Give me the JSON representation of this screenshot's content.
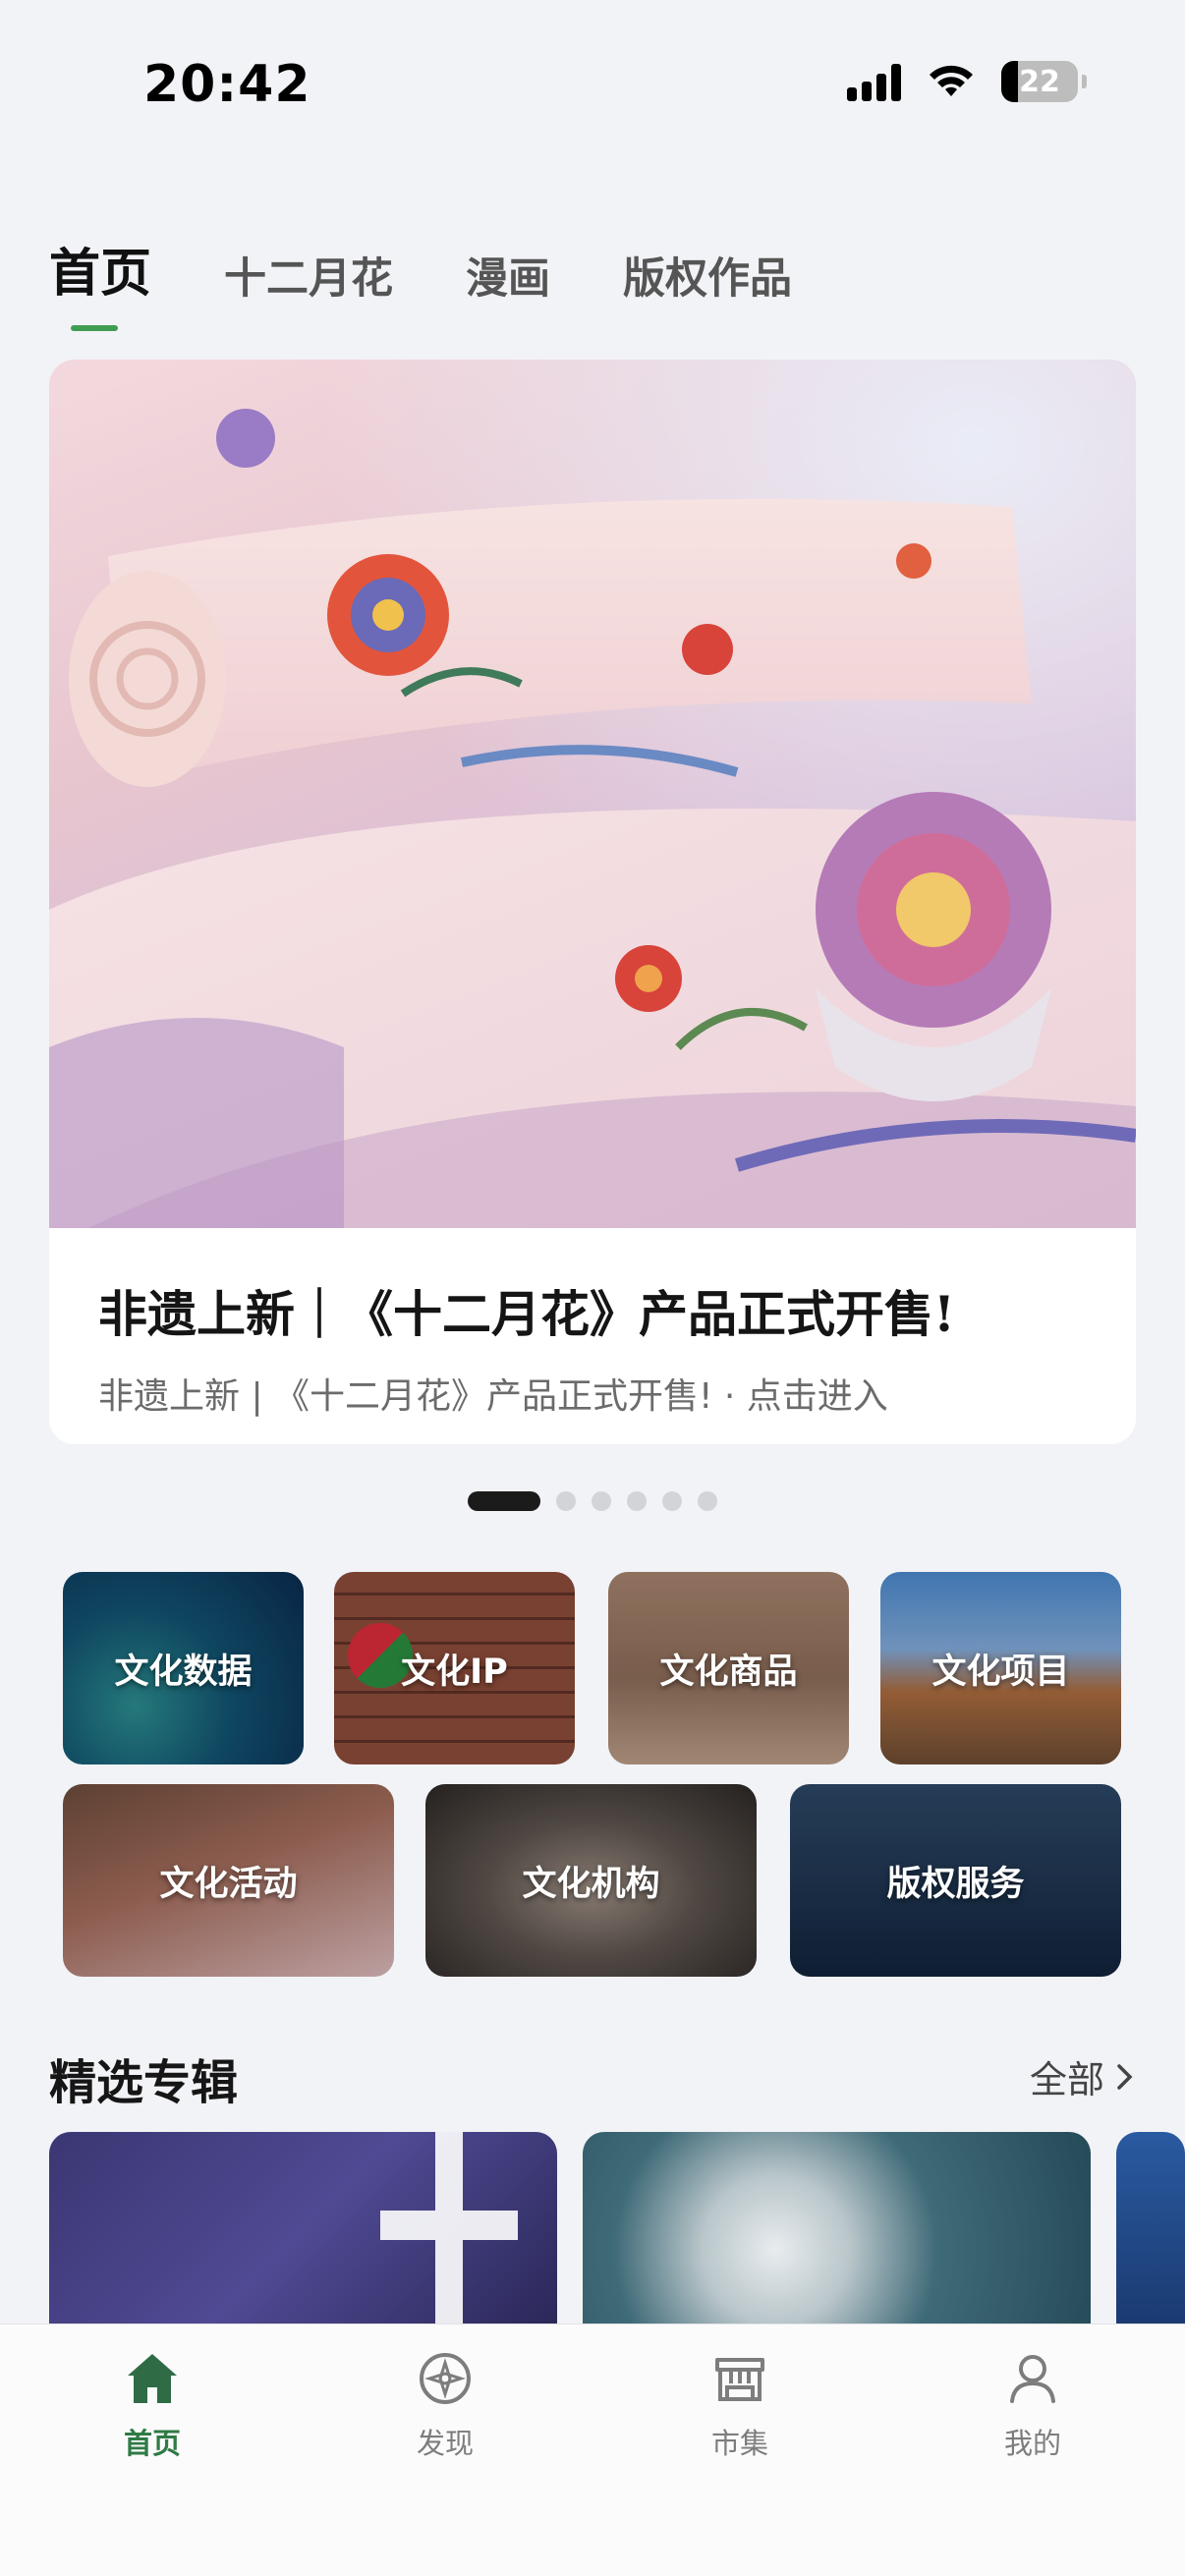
{
  "status_bar": {
    "time": "20:42",
    "battery": "22"
  },
  "top_tabs": [
    {
      "label": "首页",
      "active": true
    },
    {
      "label": "十二月花",
      "active": false
    },
    {
      "label": "漫画",
      "active": false
    },
    {
      "label": "版权作品",
      "active": false
    }
  ],
  "banner": {
    "title": "非遗上新｜《十二月花》产品正式开售!",
    "subtitle": "非遗上新 | 《十二月花》产品正式开售!  · 点击进入",
    "dot_count": 6,
    "active_dot": 0
  },
  "categories": [
    {
      "label": "文化数据"
    },
    {
      "label": "文化IP"
    },
    {
      "label": "文化商品"
    },
    {
      "label": "文化项目"
    },
    {
      "label": "文化活动"
    },
    {
      "label": "文化机构"
    },
    {
      "label": "版权服务"
    }
  ],
  "featured": {
    "title": "精选专辑",
    "more_label": "全部"
  },
  "bottom_nav": [
    {
      "label": "首页",
      "icon": "home-icon",
      "active": true
    },
    {
      "label": "发现",
      "icon": "compass-icon",
      "active": false
    },
    {
      "label": "市集",
      "icon": "market-icon",
      "active": false
    },
    {
      "label": "我的",
      "icon": "user-icon",
      "active": false
    }
  ],
  "colors": {
    "accent_green": "#3f9d52",
    "nav_active": "#2f7a45",
    "background": "#f2f3f6"
  }
}
